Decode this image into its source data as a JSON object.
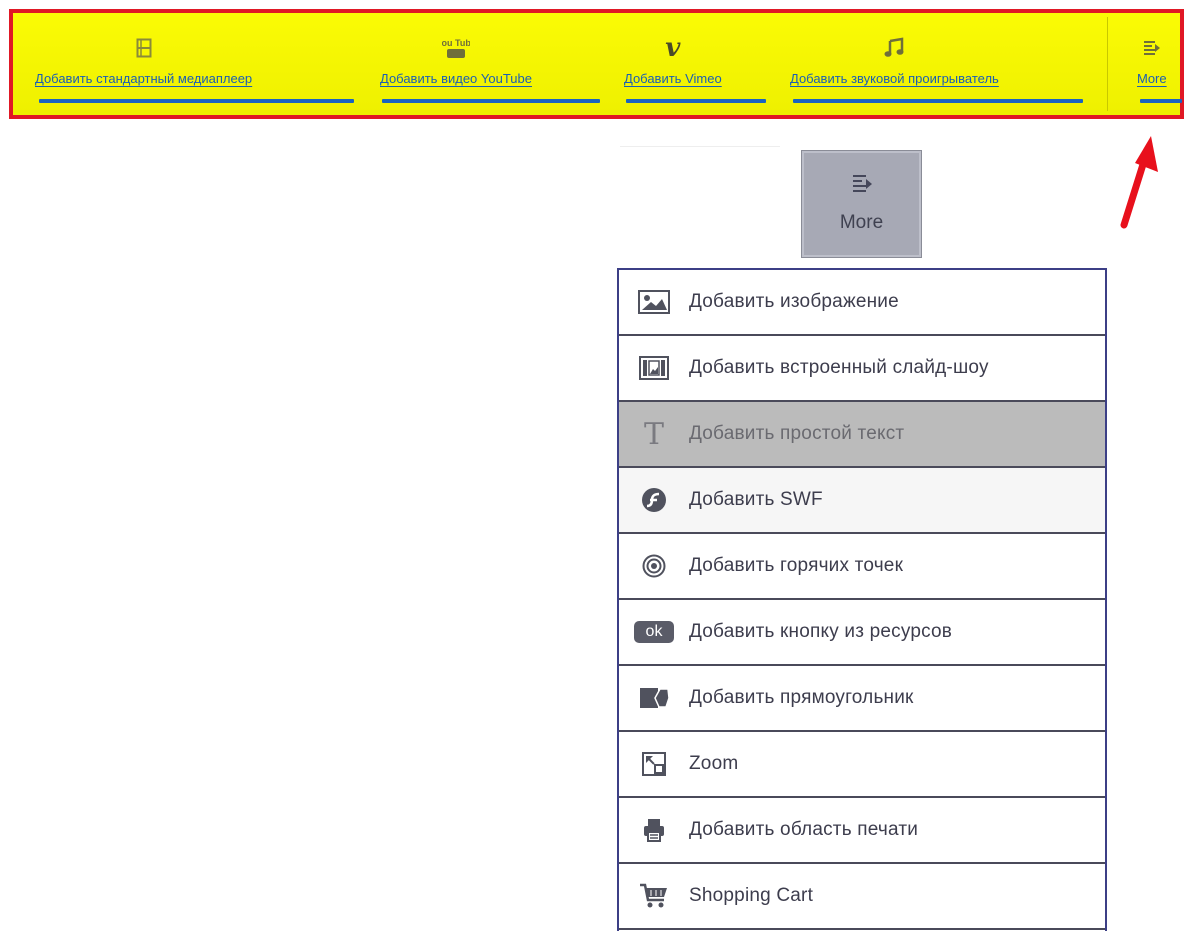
{
  "toolbar": {
    "items": [
      {
        "label": "Добавить стандартный  медиаплеер",
        "icon": "film-icon"
      },
      {
        "label": "Добавить видео YouTube",
        "icon": "youtube-icon",
        "icon_text": "You Tube"
      },
      {
        "label": "Добавить Vimeo",
        "icon": "vimeo-icon",
        "icon_text": "v"
      },
      {
        "label": "Добавить звуковой проигрыватель",
        "icon": "music-note-icon"
      },
      {
        "label": "More",
        "icon": "more-list-icon"
      }
    ]
  },
  "more_button": {
    "label": "More",
    "icon": "more-list-icon"
  },
  "menu": {
    "items": [
      {
        "label": "Добавить изображение",
        "icon": "image-icon"
      },
      {
        "label": "Добавить встроенный слайд-шоу",
        "icon": "slideshow-icon"
      },
      {
        "label": "Добавить простой текст",
        "icon": "text-icon",
        "icon_text": "T"
      },
      {
        "label": "Добавить SWF",
        "icon": "flash-icon"
      },
      {
        "label": "Добавить горячих точек",
        "icon": "hotspot-icon"
      },
      {
        "label": "Добавить кнопку из ресурсов",
        "icon": "ok-button-icon",
        "icon_text": "ok"
      },
      {
        "label": "Добавить прямоугольник",
        "icon": "shape-icon"
      },
      {
        "label": "Zoom",
        "icon": "zoom-icon"
      },
      {
        "label": "Добавить область печати",
        "icon": "print-icon"
      },
      {
        "label": "Shopping Cart",
        "icon": "cart-icon"
      }
    ]
  },
  "colors": {
    "toolbar_bg": "#f4f500",
    "toolbar_border": "#e01825",
    "label_link": "#1a5fb4",
    "underline": "#1a64c0",
    "arrow": "#e8101c",
    "menu_border": "#3c3f86",
    "highlight_row": "#bbbbbb"
  }
}
